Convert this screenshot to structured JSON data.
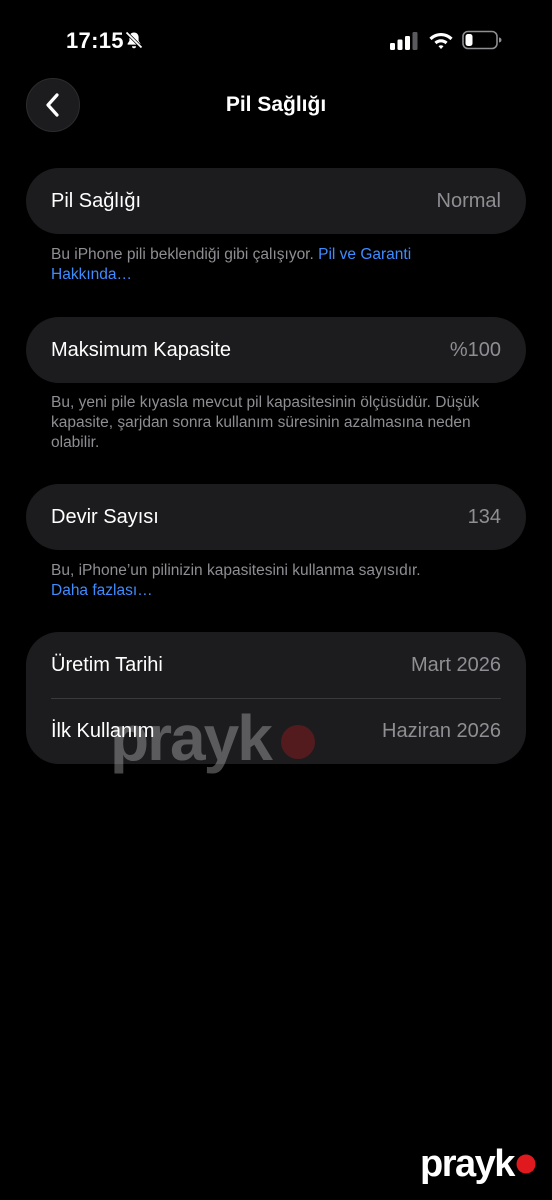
{
  "status_bar": {
    "time": "17:15",
    "icons": [
      "bell-slash-icon",
      "cellular-signal-icon",
      "wifi-icon",
      "battery-icon"
    ]
  },
  "nav": {
    "title": "Pil Sağlığı",
    "back_icon": "chevron-left-icon"
  },
  "battery_health": {
    "label": "Pil Sağlığı",
    "value": "Normal",
    "footnote_text": "Bu iPhone pili beklendiği gibi çalışıyor. ",
    "footnote_link": "Pil ve Garanti Hakkında…"
  },
  "max_capacity": {
    "label": "Maksimum Kapasite",
    "value": "%100",
    "footnote_text": "Bu, yeni pile kıyasla mevcut pil kapasitesinin ölçüsüdür. Düşük kapasite, şarjdan sonra kullanım süresinin azalmasına neden olabilir."
  },
  "cycle_count": {
    "label": "Devir Sayısı",
    "value": "134",
    "footnote_text": "Bu, iPhone’un pilinizin kapasitesini kullanma sayısıdır.",
    "footnote_link": "Daha fazlası…"
  },
  "dates": {
    "manufacture_label": "Üretim Tarihi",
    "manufacture_value": "Mart 2026",
    "first_use_label": "İlk Kullanım",
    "first_use_value": "Haziran 2026"
  },
  "watermark": {
    "text": "prayk",
    "dot_color": "#e0191e"
  },
  "colors": {
    "background": "#000000",
    "cell": "#1c1c1e",
    "secondary_text": "#8e8e93",
    "link": "#3f8cff"
  }
}
